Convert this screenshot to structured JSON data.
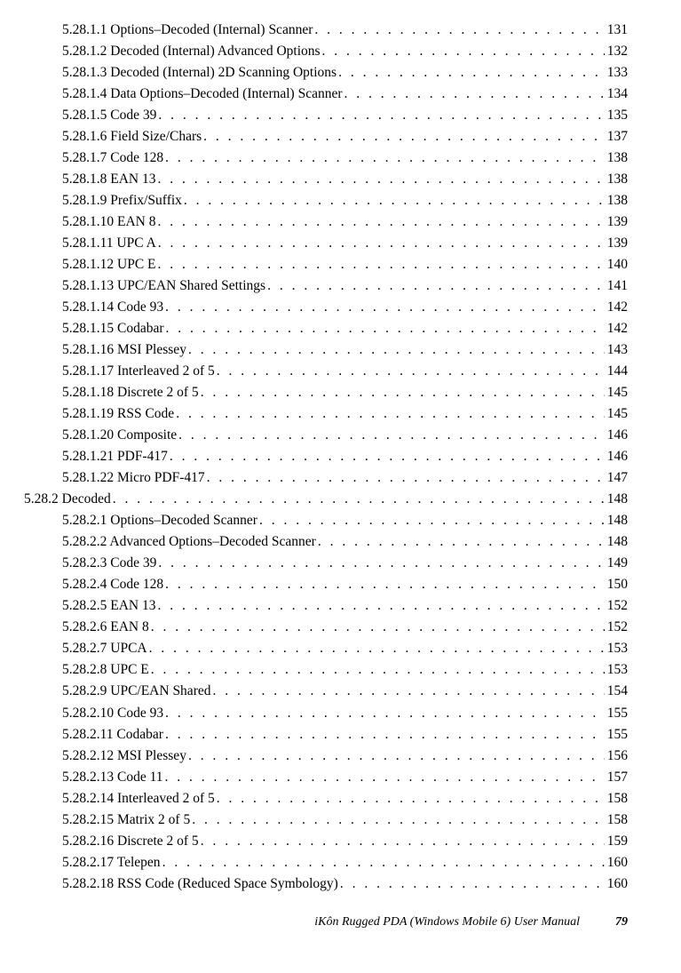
{
  "footer": {
    "title": "iKôn Rugged PDA (Windows Mobile 6) User Manual",
    "page": "79"
  },
  "toc": [
    {
      "level": 3,
      "num": "5.28.1.1",
      "title": "Options–Decoded (Internal) Scanner",
      "page": "131"
    },
    {
      "level": 3,
      "num": "5.28.1.2",
      "title": "Decoded (Internal) Advanced Options",
      "page": "132"
    },
    {
      "level": 3,
      "num": "5.28.1.3",
      "title": "Decoded (Internal) 2D Scanning Options",
      "page": "133"
    },
    {
      "level": 3,
      "num": "5.28.1.4",
      "title": "Data Options–Decoded (Internal) Scanner",
      "page": "134"
    },
    {
      "level": 3,
      "num": "5.28.1.5",
      "title": "Code 39",
      "page": "135"
    },
    {
      "level": 3,
      "num": "5.28.1.6",
      "title": "Field Size/Chars",
      "page": "137"
    },
    {
      "level": 3,
      "num": "5.28.1.7",
      "title": "Code 128",
      "page": "138"
    },
    {
      "level": 3,
      "num": "5.28.1.8",
      "title": "EAN 13",
      "page": "138"
    },
    {
      "level": 3,
      "num": "5.28.1.9",
      "title": "Prefix/Suffix",
      "page": "138"
    },
    {
      "level": 3,
      "num": "5.28.1.10",
      "title": "EAN 8",
      "page": "139"
    },
    {
      "level": 3,
      "num": "5.28.1.11",
      "title": "UPC A",
      "page": "139"
    },
    {
      "level": 3,
      "num": "5.28.1.12",
      "title": "UPC E",
      "page": "140"
    },
    {
      "level": 3,
      "num": "5.28.1.13",
      "title": "UPC/EAN Shared Settings",
      "page": "141"
    },
    {
      "level": 3,
      "num": "5.28.1.14",
      "title": "Code 93",
      "page": "142"
    },
    {
      "level": 3,
      "num": "5.28.1.15",
      "title": "Codabar",
      "page": "142"
    },
    {
      "level": 3,
      "num": "5.28.1.16",
      "title": "MSI Plessey",
      "page": "143"
    },
    {
      "level": 3,
      "num": "5.28.1.17",
      "title": "Interleaved 2 of 5",
      "page": "144"
    },
    {
      "level": 3,
      "num": "5.28.1.18",
      "title": "Discrete 2 of 5",
      "page": "145"
    },
    {
      "level": 3,
      "num": "5.28.1.19",
      "title": "RSS Code",
      "page": "145"
    },
    {
      "level": 3,
      "num": "5.28.1.20",
      "title": "Composite",
      "page": "146"
    },
    {
      "level": 3,
      "num": "5.28.1.21",
      "title": "PDF-417",
      "page": "146"
    },
    {
      "level": 3,
      "num": "5.28.1.22",
      "title": "Micro PDF-417",
      "page": "147"
    },
    {
      "level": 2,
      "num": "5.28.2",
      "title": "Decoded",
      "page": "148"
    },
    {
      "level": 3,
      "num": "5.28.2.1",
      "title": "Options–Decoded Scanner",
      "page": "148"
    },
    {
      "level": 3,
      "num": "5.28.2.2",
      "title": "Advanced Options–Decoded Scanner",
      "page": "148"
    },
    {
      "level": 3,
      "num": "5.28.2.3",
      "title": "Code 39",
      "page": "149"
    },
    {
      "level": 3,
      "num": "5.28.2.4",
      "title": "Code 128",
      "page": "150"
    },
    {
      "level": 3,
      "num": "5.28.2.5",
      "title": "EAN 13",
      "page": "152"
    },
    {
      "level": 3,
      "num": "5.28.2.6",
      "title": "EAN 8",
      "page": "152"
    },
    {
      "level": 3,
      "num": "5.28.2.7",
      "title": "UPCA",
      "page": "153"
    },
    {
      "level": 3,
      "num": "5.28.2.8",
      "title": "UPC E",
      "page": "153"
    },
    {
      "level": 3,
      "num": "5.28.2.9",
      "title": "UPC/EAN Shared",
      "page": "154"
    },
    {
      "level": 3,
      "num": "5.28.2.10",
      "title": "Code 93",
      "page": "155"
    },
    {
      "level": 3,
      "num": "5.28.2.11",
      "title": "Codabar",
      "page": "155"
    },
    {
      "level": 3,
      "num": "5.28.2.12",
      "title": "MSI Plessey",
      "page": "156"
    },
    {
      "level": 3,
      "num": "5.28.2.13",
      "title": "Code 11",
      "page": "157"
    },
    {
      "level": 3,
      "num": "5.28.2.14",
      "title": "Interleaved 2 of 5",
      "page": "158"
    },
    {
      "level": 3,
      "num": "5.28.2.15",
      "title": "Matrix 2 of 5",
      "page": "158"
    },
    {
      "level": 3,
      "num": "5.28.2.16",
      "title": "Discrete 2 of 5",
      "page": "159"
    },
    {
      "level": 3,
      "num": "5.28.2.17",
      "title": "Telepen",
      "page": "160"
    },
    {
      "level": 3,
      "num": "5.28.2.18",
      "title": "RSS Code (Reduced Space Symbology)",
      "page": "160"
    }
  ]
}
